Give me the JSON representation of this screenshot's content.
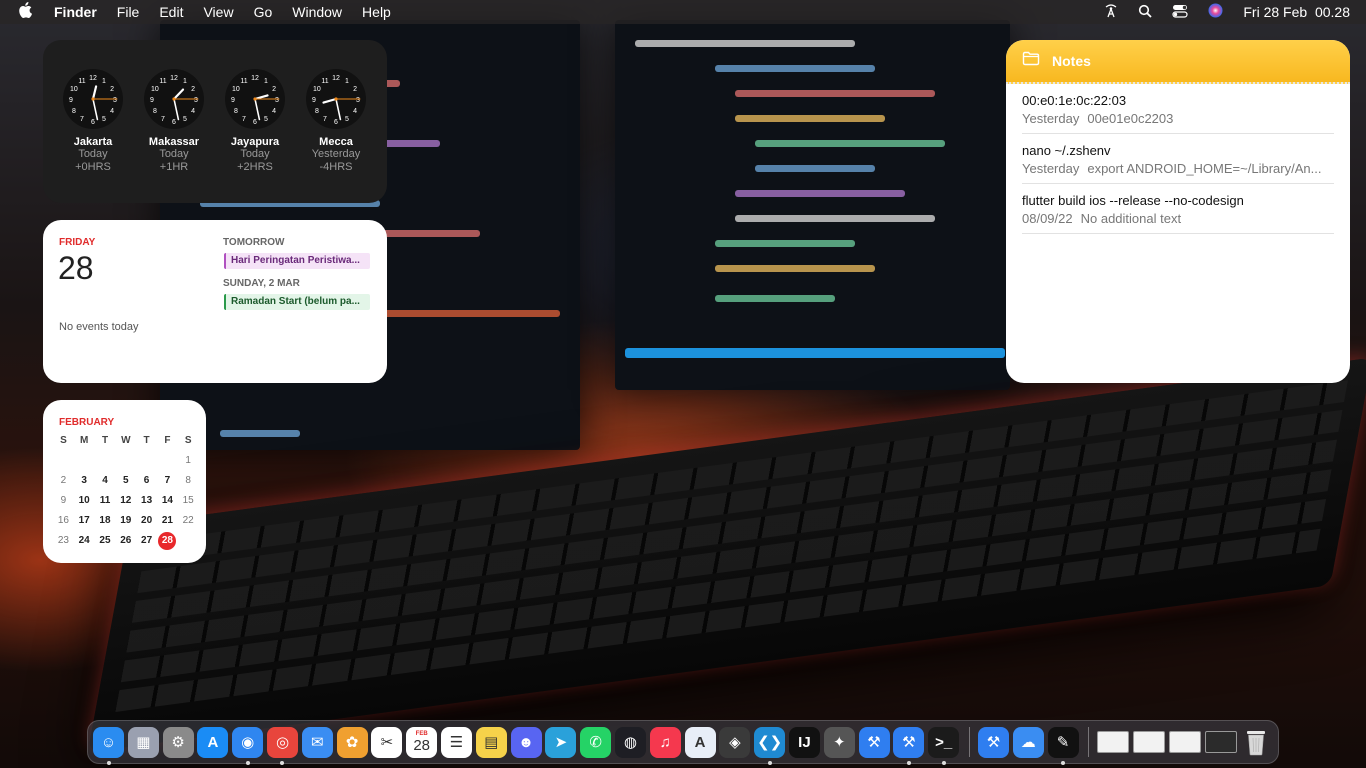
{
  "menubar": {
    "app_name": "Finder",
    "menus": [
      "File",
      "Edit",
      "View",
      "Go",
      "Window",
      "Help"
    ],
    "datetime": "Fri 28 Feb  00.28"
  },
  "world_clock": [
    {
      "city": "Jakarta",
      "day": "Today",
      "offset": "+0HRS",
      "hour": 0,
      "minute": 28
    },
    {
      "city": "Makassar",
      "day": "Today",
      "offset": "+1HR",
      "hour": 1,
      "minute": 28
    },
    {
      "city": "Jayapura",
      "day": "Today",
      "offset": "+2HRS",
      "hour": 2,
      "minute": 28
    },
    {
      "city": "Mecca",
      "day": "Yesterday",
      "offset": "-4HRS",
      "hour": 20,
      "minute": 28
    }
  ],
  "calendar_events": {
    "weekday": "FRIDAY",
    "day": "28",
    "no_events": "No events today",
    "tomorrow_label": "TOMORROW",
    "tomorrow_event": "Hari Peringatan Peristiwa...",
    "sunday_label": "SUNDAY, 2 MAR",
    "sunday_event": "Ramadan Start (belum pa..."
  },
  "month": {
    "name": "FEBRUARY",
    "weekdays": [
      "S",
      "M",
      "T",
      "W",
      "T",
      "F",
      "S"
    ],
    "weeks": [
      [
        "",
        "",
        "",
        "",
        "",
        "",
        "1"
      ],
      [
        "2",
        "3",
        "4",
        "5",
        "6",
        "7",
        "8"
      ],
      [
        "9",
        "10",
        "11",
        "12",
        "13",
        "14",
        "15"
      ],
      [
        "16",
        "17",
        "18",
        "19",
        "20",
        "21",
        "22"
      ],
      [
        "23",
        "24",
        "25",
        "26",
        "27",
        "28",
        ""
      ]
    ],
    "today": "28"
  },
  "notes": {
    "title": "Notes",
    "items": [
      {
        "title": "00:e0:1e:0c:22:03",
        "date": "Yesterday",
        "preview": "00e01e0c2203"
      },
      {
        "title": "nano ~/.zshenv",
        "date": "Yesterday",
        "preview": "export ANDROID_HOME=~/Library/An..."
      },
      {
        "title": "flutter build ios --release --no-codesign",
        "date": "08/09/22",
        "preview": "No additional text"
      }
    ]
  },
  "dock": {
    "calendar_month": "FEB",
    "calendar_day": "28",
    "apps": [
      {
        "name": "finder-icon",
        "color": "#2a8cf0",
        "glyph": "☺",
        "running": true
      },
      {
        "name": "launchpad-icon",
        "color": "#9aa0b0",
        "glyph": "▦",
        "running": false
      },
      {
        "name": "system-settings-icon",
        "color": "#8a8a8a",
        "glyph": "⚙",
        "running": false
      },
      {
        "name": "app-store-icon",
        "color": "#1a8cf5",
        "glyph": "A",
        "running": false
      },
      {
        "name": "safari-icon",
        "color": "#2f86f0",
        "glyph": "◉",
        "running": true
      },
      {
        "name": "chrome-icon",
        "color": "#e8453c",
        "glyph": "◎",
        "running": true
      },
      {
        "name": "mail-icon",
        "color": "#3a8df2",
        "glyph": "✉",
        "running": false
      },
      {
        "name": "photos-icon",
        "color": "#f0a030",
        "glyph": "✿",
        "running": false
      },
      {
        "name": "capcut-icon",
        "color": "#ffffff",
        "glyph": "✂",
        "running": false
      },
      {
        "name": "calendar-icon",
        "color": "#ffffff",
        "glyph": "",
        "running": false
      },
      {
        "name": "reminders-icon",
        "color": "#ffffff",
        "glyph": "☰",
        "running": false
      },
      {
        "name": "notes-icon",
        "color": "#f6d24a",
        "glyph": "▤",
        "running": false
      },
      {
        "name": "discord-icon",
        "color": "#5865f2",
        "glyph": "☻",
        "running": false
      },
      {
        "name": "telegram-icon",
        "color": "#2aa1da",
        "glyph": "➤",
        "running": false
      },
      {
        "name": "whatsapp-icon",
        "color": "#25d366",
        "glyph": "✆",
        "running": false
      },
      {
        "name": "obs-icon",
        "color": "#1e1e24",
        "glyph": "◍",
        "running": false
      },
      {
        "name": "music-icon",
        "color": "#f5384e",
        "glyph": "♫",
        "running": false
      },
      {
        "name": "xcode-instruments-icon",
        "color": "#e8eef8",
        "glyph": "A",
        "running": false
      },
      {
        "name": "unity-icon",
        "color": "#3a3a3a",
        "glyph": "◈",
        "running": false
      },
      {
        "name": "vscode-icon",
        "color": "#1f8ad2",
        "glyph": "❮❯",
        "running": true
      },
      {
        "name": "intellij-icon",
        "color": "#111111",
        "glyph": "IJ",
        "running": false
      },
      {
        "name": "inkscape-icon",
        "color": "#555555",
        "glyph": "✦",
        "running": false
      },
      {
        "name": "xcode-icon",
        "color": "#2f7ef0",
        "glyph": "⚒",
        "running": false
      },
      {
        "name": "simulator-icon",
        "color": "#2f7ef0",
        "glyph": "⚒",
        "running": true
      },
      {
        "name": "terminal-icon",
        "color": "#1b1b1b",
        "glyph": ">_",
        "running": true
      }
    ],
    "extra_apps": [
      {
        "name": "xcode-beta-icon",
        "color": "#2f7ef0",
        "glyph": "⚒",
        "running": false
      },
      {
        "name": "weather-icon",
        "color": "#3a8df2",
        "glyph": "☁",
        "running": false
      },
      {
        "name": "youtube-studio-icon",
        "color": "#111111",
        "glyph": "✎",
        "running": true
      }
    ]
  },
  "colors": {
    "accent_red": "#e02b2b",
    "notes_yellow": "#f8b820"
  }
}
